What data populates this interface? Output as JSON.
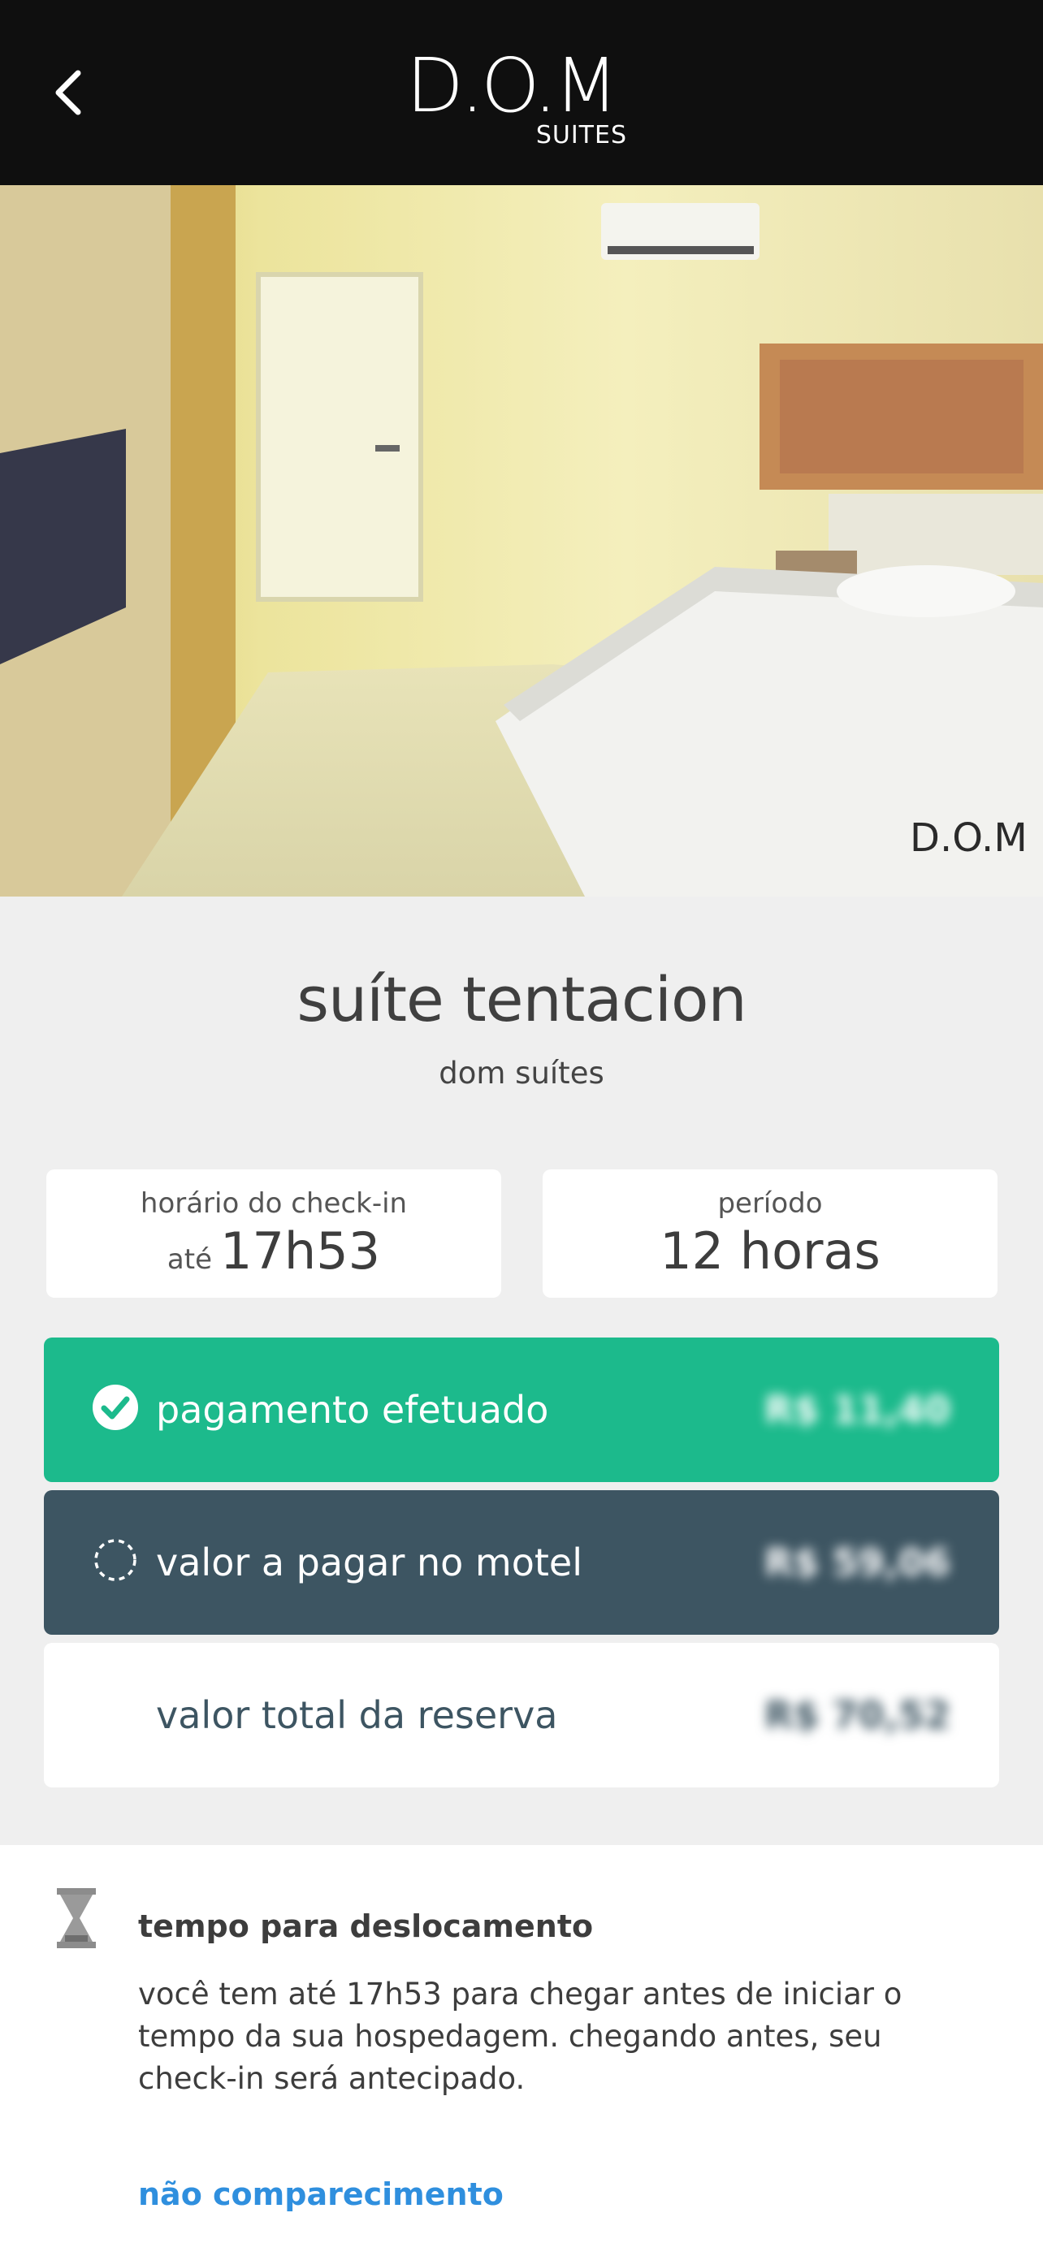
{
  "header": {
    "logo_main": "D.O.M",
    "logo_sub": "SUITES"
  },
  "hero_image": {
    "description_icon": "room-photo"
  },
  "suite": {
    "name": "suíte tentacion",
    "hotel": "dom suítes"
  },
  "checkin": {
    "label": "horário do check-in",
    "prefix": "até",
    "time": "17h53"
  },
  "period": {
    "label": "período",
    "value": "12 horas"
  },
  "payments": {
    "paid": {
      "label": "pagamento efetuado",
      "amount": "R$ 11,40"
    },
    "pending": {
      "label": "valor a pagar no motel",
      "amount": "R$ 59,06"
    },
    "total": {
      "label": "valor total da reserva",
      "amount": "R$ 70,52"
    }
  },
  "travel": {
    "title": "tempo para deslocamento",
    "text": "você tem até 17h53 para chegar antes de iniciar o tempo da sua hospedagem. chegando antes, seu check-in será antecipado.",
    "link": "não comparecimento"
  },
  "colors": {
    "paid": "#1cba8c",
    "pending": "#3d5562",
    "link": "#2f8fde",
    "header": "#0f0f0f"
  }
}
